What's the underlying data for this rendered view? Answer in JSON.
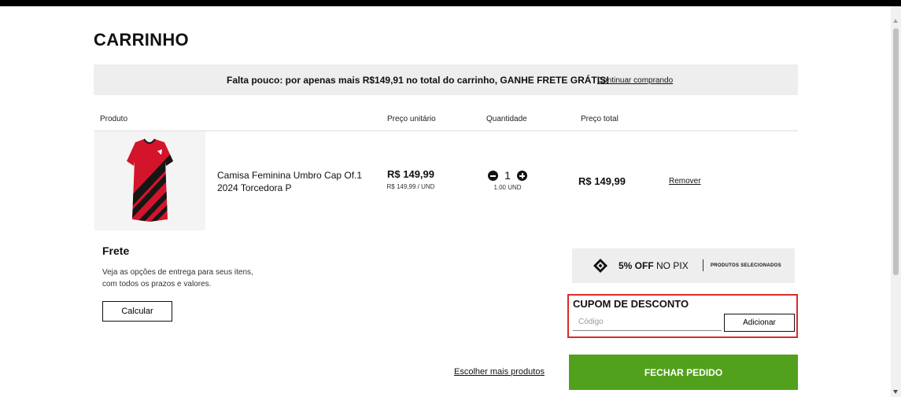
{
  "page": {
    "title": "CARRINHO"
  },
  "banner": {
    "message": "Falta pouco: por apenas mais R$149,91 no total do carrinho, GANHE FRETE GRÁTIS!",
    "link_label": "Continuar comprando"
  },
  "table": {
    "headers": [
      "Produto",
      "Preço unitário",
      "Quantidade",
      "Preço total"
    ],
    "items": [
      {
        "name": "Camisa Feminina Umbro Cap Of.1 2024 Torcedora P",
        "unit_price": "R$ 149,99",
        "unit_price_sub": "R$ 149,99 / UND",
        "quantity": "1",
        "quantity_sub": "1.00 UND",
        "total_price": "R$ 149,99",
        "remove_label": "Remover",
        "thumbnail_icon": "jersey-icon"
      }
    ]
  },
  "shipping": {
    "title": "Frete",
    "description": "Veja as opções de entrega para seus itens, com todos os prazos e valores.",
    "button_label": "Calcular"
  },
  "pix": {
    "discount": "5% OFF",
    "method": "NO PIX",
    "note": "PRODUTOS SELECIONADOS",
    "icon": "pix-icon"
  },
  "coupon": {
    "title": "CUPOM DE DESCONTO",
    "placeholder": "Código",
    "value": "",
    "button_label": "Adicionar"
  },
  "footer": {
    "more_products_label": "Escolher mais produtos",
    "checkout_label": "FECHAR PEDIDO"
  },
  "colors": {
    "checkout_green": "#52a11d",
    "highlight_red": "#d92b2b",
    "banner_bg": "#eeeeee",
    "jersey_red": "#d3142b",
    "jersey_black": "#161616"
  }
}
